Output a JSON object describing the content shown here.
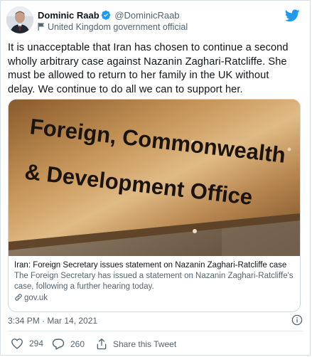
{
  "author": {
    "name": "Dominic Raab",
    "handle": "@DominicRaab",
    "label": "United Kingdom government official"
  },
  "tweet": {
    "text": "It is unacceptable that Iran has chosen to continue a second wholly arbitrary case against Nazanin Zaghari-Ratcliffe. She must be allowed to return to her family in the UK without delay. We continue to do all we can to support her.",
    "timestamp": "3:34 PM · Mar 14, 2021"
  },
  "card": {
    "sign_lines": [
      "Foreign, Commonwealth",
      "& Development Office"
    ],
    "title": "Iran: Foreign Secretary issues statement on Nazanin Zaghari-Ratcliffe case",
    "description": "The Foreign Secretary has issued a statement on Nazanin Zaghari-Ratcliffe's case, following a further hearing today.",
    "domain": "gov.uk"
  },
  "actions": {
    "likes": "294",
    "replies": "260",
    "share_label": "Share this Tweet"
  },
  "icons": {
    "verified": "verified-badge-icon",
    "flag": "flag-icon",
    "brand": "twitter-bird-icon",
    "link": "link-icon",
    "info": "info-icon",
    "like": "heart-icon",
    "reply": "reply-bubble-icon",
    "share": "share-icon"
  },
  "colors": {
    "brand": "#1d9bf0",
    "text": "#0f1419",
    "secondary": "#536471",
    "plaque": "#b8874e"
  }
}
